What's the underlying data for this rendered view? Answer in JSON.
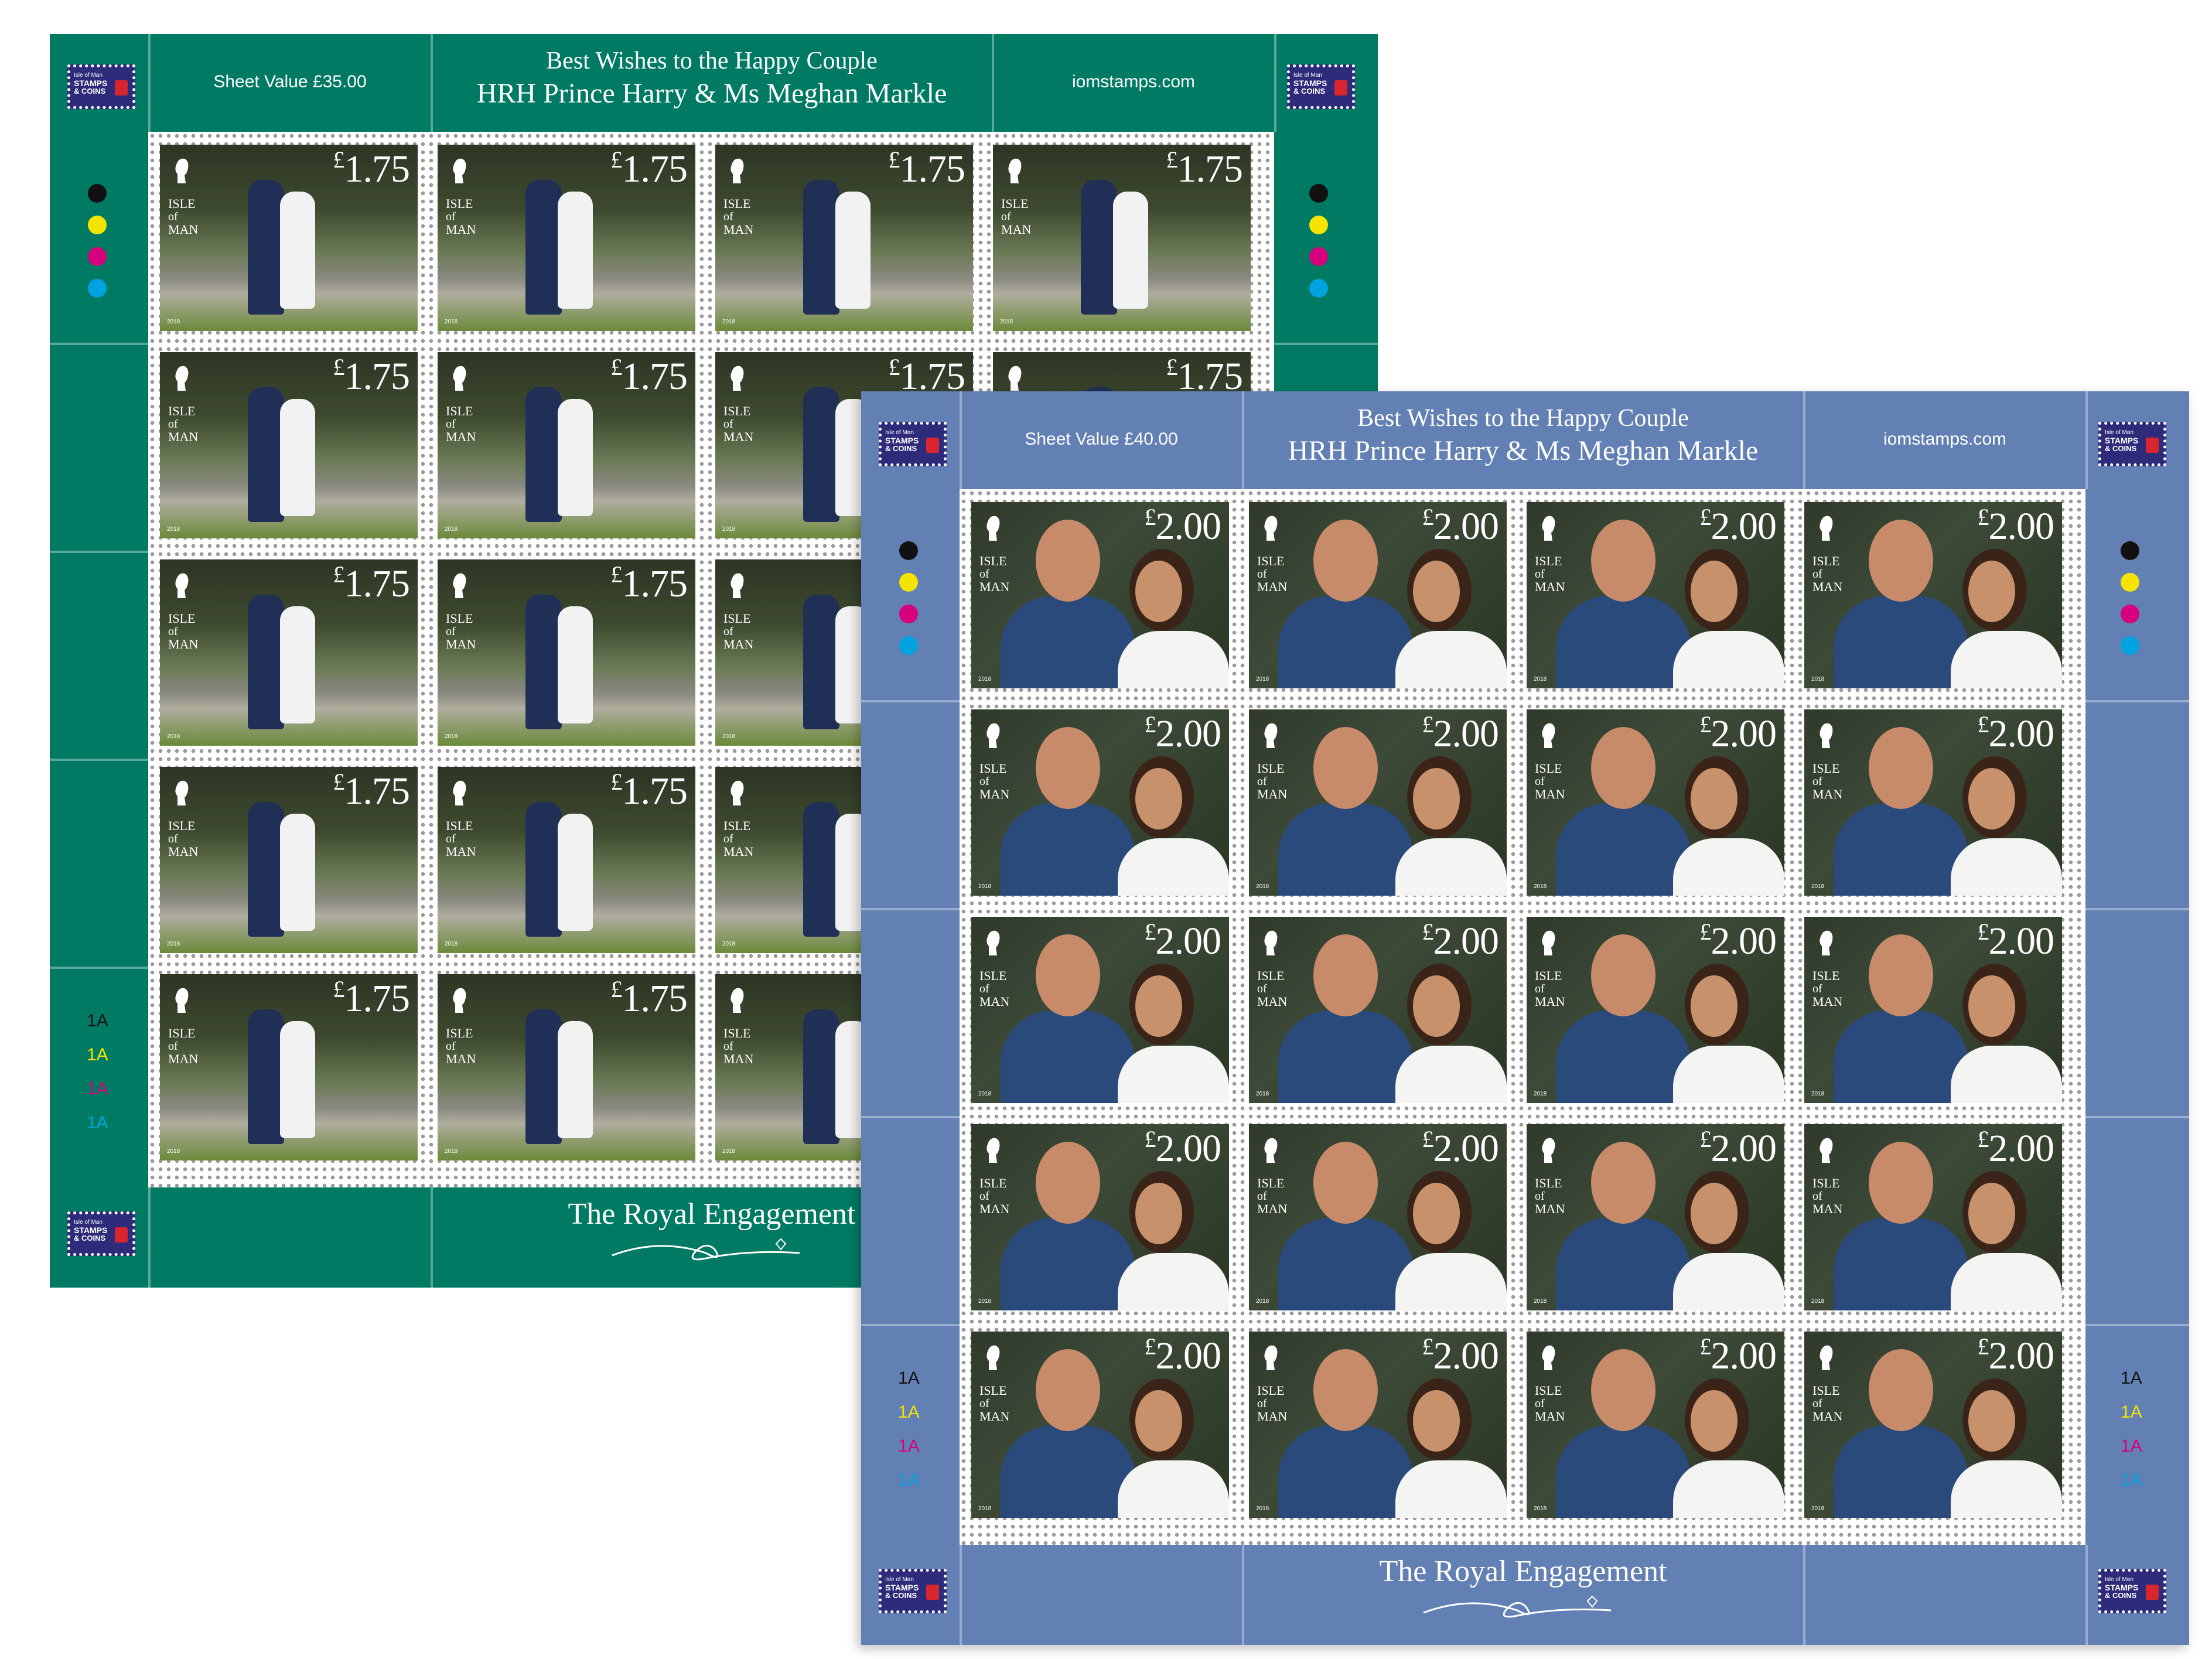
{
  "sheets": [
    {
      "id": "green",
      "background": "#007a63",
      "sheet_value": "Sheet Value £35.00",
      "title_line1": "Best Wishes to the Happy Couple",
      "title_line2": "HRH Prince Harry & Ms Meghan Markle",
      "website": "iomstamps.com",
      "footer_title": "The Royal Engagement",
      "stamp_value": "1.75",
      "currency": "£",
      "country": [
        "ISLE",
        "of",
        "MAN"
      ],
      "year": "2018",
      "rows": 5,
      "cols": 4,
      "plate_codes": [
        "1A",
        "1A",
        "1A",
        "1A"
      ]
    },
    {
      "id": "blue",
      "background": "#6380b5",
      "sheet_value": "Sheet Value £40.00",
      "title_line1": "Best Wishes to the Happy Couple",
      "title_line2": "HRH Prince Harry & Ms Meghan Markle",
      "website": "iomstamps.com",
      "footer_title": "The Royal Engagement",
      "stamp_value": "2.00",
      "currency": "£",
      "country": [
        "ISLE",
        "of",
        "MAN"
      ],
      "year": "2018",
      "rows": 5,
      "cols": 4,
      "plate_codes": [
        "1A",
        "1A",
        "1A",
        "1A"
      ]
    }
  ],
  "logo": {
    "line1": "Isle of Man",
    "line2": "STAMPS",
    "line3": "& COINS"
  },
  "colour_dots": [
    "#111111",
    "#f5e400",
    "#d6007e",
    "#00a3e0"
  ]
}
